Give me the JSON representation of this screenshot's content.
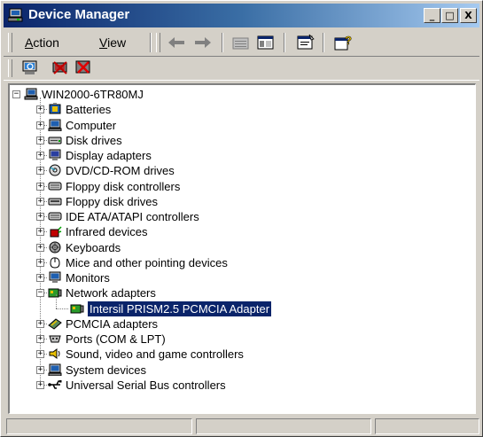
{
  "window": {
    "title": "Device Manager",
    "controls": [
      "_",
      "□",
      "X"
    ]
  },
  "menu": {
    "action": {
      "accel": "A",
      "rest": "ction"
    },
    "view": {
      "accel": "V",
      "rest": "iew"
    }
  },
  "toolbar_icons": [
    "back-arrow-icon",
    "forward-arrow-icon",
    "up-folder-icon",
    "show-hide-tree-icon",
    "properties-icon",
    "help-icon"
  ],
  "toolbar2_icons": [
    "scan-hardware-icon",
    "uninstall-icon",
    "disable-icon"
  ],
  "tree": {
    "root": "WIN2000-6TR80MJ",
    "categories": [
      {
        "label": "Batteries",
        "icon": "battery-icon",
        "expanded": false
      },
      {
        "label": "Computer",
        "icon": "computer-icon",
        "expanded": false
      },
      {
        "label": "Disk drives",
        "icon": "disk-drive-icon",
        "expanded": false
      },
      {
        "label": "Display adapters",
        "icon": "display-icon",
        "expanded": false
      },
      {
        "label": "DVD/CD-ROM drives",
        "icon": "cdrom-icon",
        "expanded": false
      },
      {
        "label": "Floppy disk controllers",
        "icon": "controller-icon",
        "expanded": false
      },
      {
        "label": "Floppy disk drives",
        "icon": "floppy-drive-icon",
        "expanded": false
      },
      {
        "label": "IDE ATA/ATAPI controllers",
        "icon": "ide-controller-icon",
        "expanded": false
      },
      {
        "label": "Infrared devices",
        "icon": "infrared-icon",
        "expanded": false
      },
      {
        "label": "Keyboards",
        "icon": "keyboard-icon",
        "expanded": false
      },
      {
        "label": "Mice and other pointing devices",
        "icon": "mouse-icon",
        "expanded": false
      },
      {
        "label": "Monitors",
        "icon": "monitor-icon",
        "expanded": false
      },
      {
        "label": "Network adapters",
        "icon": "network-adapter-icon",
        "expanded": true,
        "children": [
          {
            "label": "Intersil PRISM2.5 PCMCIA Adapter",
            "icon": "network-card-icon",
            "selected": true
          }
        ]
      },
      {
        "label": "PCMCIA adapters",
        "icon": "pcmcia-icon",
        "expanded": false
      },
      {
        "label": "Ports (COM & LPT)",
        "icon": "port-icon",
        "expanded": false
      },
      {
        "label": "Sound, video and game controllers",
        "icon": "sound-icon",
        "expanded": false
      },
      {
        "label": "System devices",
        "icon": "system-icon",
        "expanded": false
      },
      {
        "label": "Universal Serial Bus controllers",
        "icon": "usb-icon",
        "expanded": false
      }
    ]
  },
  "colors": {
    "titlebar_start": "#0a246a",
    "titlebar_end": "#a6caf0",
    "selection": "#0a246a",
    "face": "#d4d0c8"
  }
}
